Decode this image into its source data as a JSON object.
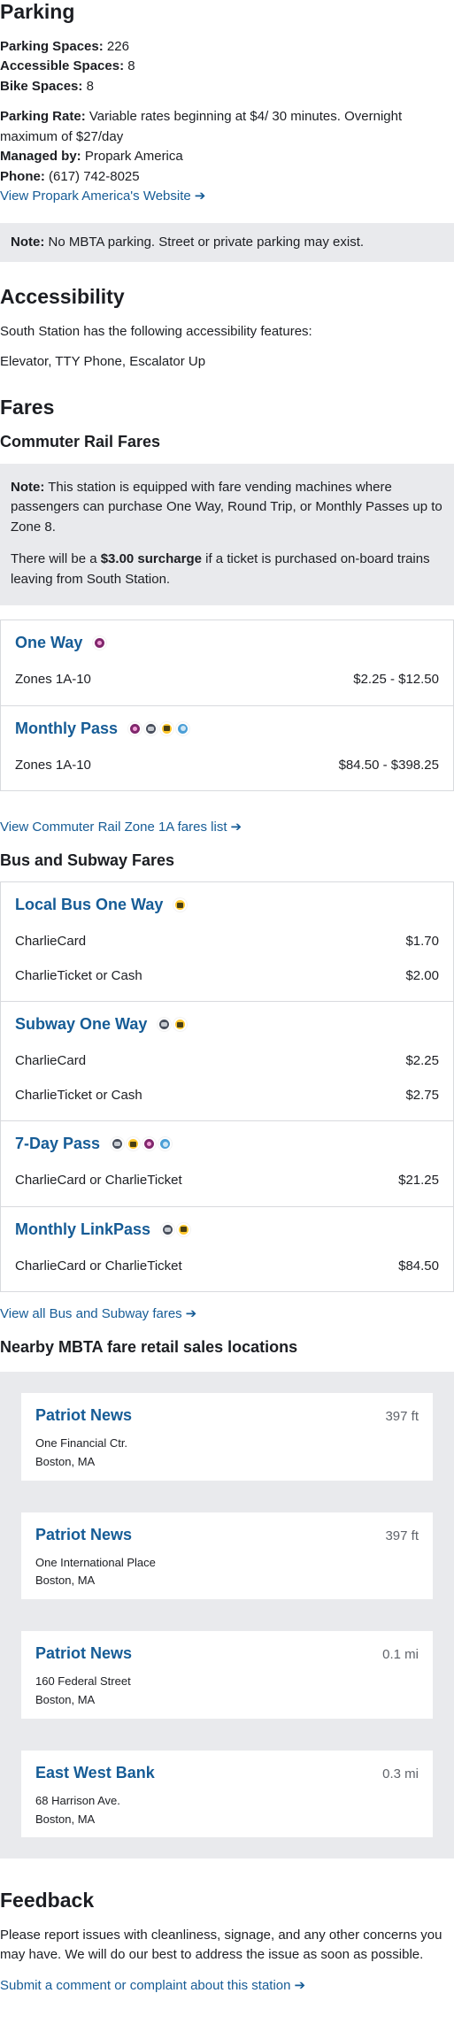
{
  "parking": {
    "heading": "Parking",
    "spaces_label": "Parking Spaces:",
    "spaces_value": "226",
    "accessible_label": "Accessible Spaces:",
    "accessible_value": "8",
    "bike_label": "Bike Spaces:",
    "bike_value": "8",
    "rate_label": "Parking Rate:",
    "rate_value": "Variable rates beginning at $4/ 30 minutes. Overnight maximum of $27/day",
    "managed_label": "Managed by:",
    "managed_value": "Propark America",
    "phone_label": "Phone:",
    "phone_value": "(617) 742-8025",
    "website_link": "View Propark America's Website",
    "note_label": "Note:",
    "note_text": "No MBTA parking. Street or private parking may exist."
  },
  "accessibility": {
    "heading": "Accessibility",
    "intro": "South Station has the following accessibility features:",
    "features": "Elevator, TTY Phone, Escalator Up"
  },
  "fares": {
    "heading": "Fares",
    "commuter_heading": "Commuter Rail Fares",
    "commuter_note_label": "Note:",
    "commuter_note_text": "This station is equipped with fare vending machines where passengers can purchase One Way, Round Trip, or Monthly Passes up to Zone 8.",
    "surcharge_pre": "There will be a",
    "surcharge_bold": "$3.00 surcharge",
    "surcharge_post": "if a ticket is purchased on-board trains leaving from South Station.",
    "commuter_groups": [
      {
        "title": "One Way",
        "modes": [
          "commuter-rail"
        ],
        "rows": [
          {
            "label": "Zones 1A-10",
            "price": "$2.25 - $12.50"
          }
        ]
      },
      {
        "title": "Monthly Pass",
        "modes": [
          "commuter-rail",
          "subway",
          "bus",
          "ferry"
        ],
        "rows": [
          {
            "label": "Zones 1A-10",
            "price": "$84.50 - $398.25"
          }
        ]
      }
    ],
    "zone_link": "View Commuter Rail Zone 1A fares list",
    "bus_heading": "Bus and Subway Fares",
    "bus_groups": [
      {
        "title": "Local Bus One Way",
        "modes": [
          "bus"
        ],
        "rows": [
          {
            "label": "CharlieCard",
            "price": "$1.70"
          },
          {
            "label": "CharlieTicket or Cash",
            "price": "$2.00"
          }
        ]
      },
      {
        "title": "Subway One Way",
        "modes": [
          "subway",
          "bus"
        ],
        "rows": [
          {
            "label": "CharlieCard",
            "price": "$2.25"
          },
          {
            "label": "CharlieTicket or Cash",
            "price": "$2.75"
          }
        ]
      },
      {
        "title": "7-Day Pass",
        "modes": [
          "subway",
          "bus",
          "commuter-rail",
          "ferry"
        ],
        "rows": [
          {
            "label": "CharlieCard or CharlieTicket",
            "price": "$21.25"
          }
        ]
      },
      {
        "title": "Monthly LinkPass",
        "modes": [
          "subway",
          "bus"
        ],
        "rows": [
          {
            "label": "CharlieCard or CharlieTicket",
            "price": "$84.50"
          }
        ]
      }
    ],
    "bus_link": "View all Bus and Subway fares"
  },
  "retail": {
    "heading": "Nearby MBTA fare retail sales locations",
    "locations": [
      {
        "name": "Patriot News",
        "distance": "397 ft",
        "line1": "One Financial Ctr.",
        "line2": "Boston, MA"
      },
      {
        "name": "Patriot News",
        "distance": "397 ft",
        "line1": "One International Place",
        "line2": "Boston, MA"
      },
      {
        "name": "Patriot News",
        "distance": "0.1 mi",
        "line1": "160 Federal Street",
        "line2": "Boston, MA"
      },
      {
        "name": "East West Bank",
        "distance": "0.3 mi",
        "line1": "68 Harrison Ave.",
        "line2": "Boston, MA"
      }
    ]
  },
  "feedback": {
    "heading": "Feedback",
    "text": "Please report issues with cleanliness, signage, and any other concerns you may have. We will do our best to address the issue as soon as possible.",
    "link": "Submit a comment or complaint about this station"
  },
  "colors": {
    "link": "#165c96",
    "note_bg": "#e9eaed",
    "commuter_rail": "#80276c",
    "subway": "#494f5c",
    "bus": "#ffc72c",
    "ferry": "#4a9ed6"
  }
}
